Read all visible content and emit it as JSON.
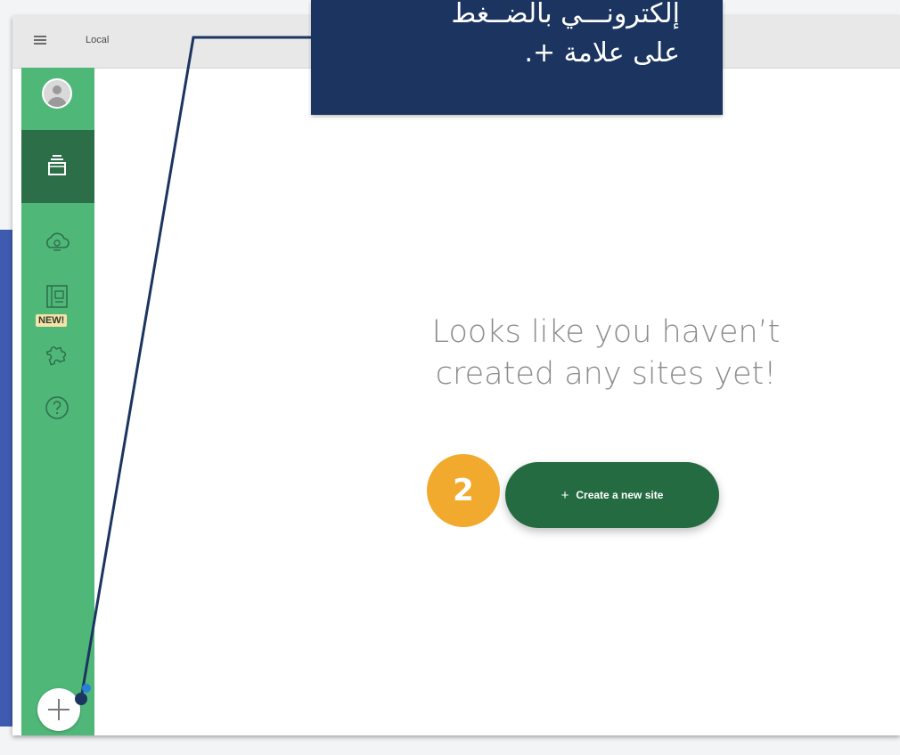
{
  "window": {
    "title": "Local"
  },
  "sidebar": {
    "items": [
      {
        "name": "profile",
        "icon": "avatar-icon"
      },
      {
        "name": "local-sites",
        "icon": "sites-stack-icon",
        "active": true
      },
      {
        "name": "connect",
        "icon": "cloud-icon"
      },
      {
        "name": "blueprints",
        "icon": "blueprint-icon"
      },
      {
        "name": "add-ons",
        "icon": "puzzle-icon"
      },
      {
        "name": "help",
        "icon": "question-icon"
      }
    ],
    "new_badge": "NEW!",
    "add_site_icon": "plus-icon"
  },
  "main": {
    "empty_line1": "Looks like you haven’t",
    "empty_line2": "created any sites yet!",
    "create_button": {
      "plus": "+",
      "label": "Create a new site"
    }
  },
  "annotation": {
    "step_number": "2",
    "callout_line1": "إلكترونـــي بالضــغط",
    "callout_line2": "على علامة +."
  },
  "colors": {
    "sidebar_green": "#4fb879",
    "active_green": "#2c6e47",
    "button_green": "#256b42",
    "callout_navy": "#1c3560",
    "step_orange": "#f2aa2e",
    "badge_yellow": "#f6e3a8"
  }
}
